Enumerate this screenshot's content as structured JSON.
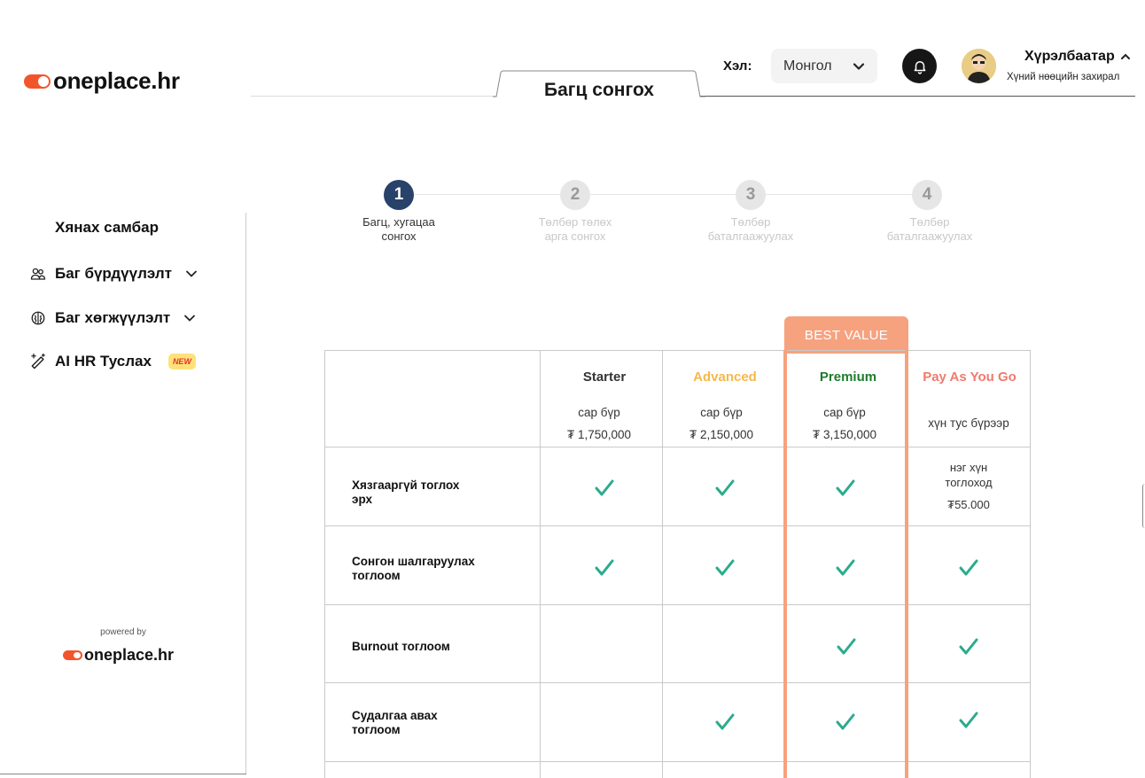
{
  "brand": {
    "logo_text": "oneplace.hr",
    "powered_by": "powered by",
    "footer_logo_text": "oneplace.hr",
    "accent": "#f2552c"
  },
  "header": {
    "page_title": "Багц сонгох",
    "language_label": "Хэл:",
    "language_value": "Монгол",
    "user_name": "Хүрэлбаатар",
    "user_role": "Хүний нөөцийн захирал"
  },
  "sidebar": {
    "title": "Хянах самбар",
    "items": [
      {
        "label": "Баг бүрдүүлэлт",
        "icon": "team-icon"
      },
      {
        "label": "Баг хөгжүүлэлт",
        "icon": "brain-icon"
      },
      {
        "label": "AI HR Туслах",
        "icon": "magic-wand-icon",
        "badge": "NEW"
      }
    ]
  },
  "stepper": {
    "steps": [
      {
        "number": "1",
        "label_line1": "Багц, хугацаа",
        "label_line2": "сонгох"
      },
      {
        "number": "2",
        "label_line1": "Төлбөр төлөх",
        "label_line2": "арга сонгох"
      },
      {
        "number": "3",
        "label_line1": "Төлбөр",
        "label_line2": "баталгаажуулах"
      },
      {
        "number": "4",
        "label_line1": "Төлбөр",
        "label_line2": "баталгаажуулах"
      }
    ],
    "active_step": 1
  },
  "pricing": {
    "best_value_label": "BEST VALUE",
    "plans": [
      {
        "name": "Starter",
        "period": "сар бүр",
        "price": "₮ 1,750,000",
        "color": "#333333"
      },
      {
        "name": "Advanced",
        "period": "сар бүр",
        "price": "₮ 2,150,000",
        "color": "#f5b84a"
      },
      {
        "name": "Premium",
        "period": "сар бүр",
        "price": "₮ 3,150,000",
        "color": "#1f7a2c"
      },
      {
        "name": "Pay As You Go",
        "period": "хүн тус бүрээр",
        "price": "",
        "color": "#f07a6e"
      }
    ],
    "rows": [
      {
        "label": "Хязгааргүй тоглох эрх",
        "cells": [
          "check",
          "check",
          "check",
          "text"
        ],
        "text_line1": "нэг хүн",
        "text_line2": "тоглоход",
        "text_price": "₮55.000"
      },
      {
        "label": "Сонгон шалгаруулах тоглоом",
        "cells": [
          "check",
          "check",
          "check",
          "check"
        ]
      },
      {
        "label": "Burnout тоглоом",
        "cells": [
          "",
          "",
          "check",
          "check"
        ]
      },
      {
        "label": "Судалгаа авах тоглоом",
        "cells": [
          "",
          "check",
          "check",
          "check"
        ]
      }
    ],
    "check_color": "#2bab8e",
    "highlight_color": "#f6a27f"
  }
}
